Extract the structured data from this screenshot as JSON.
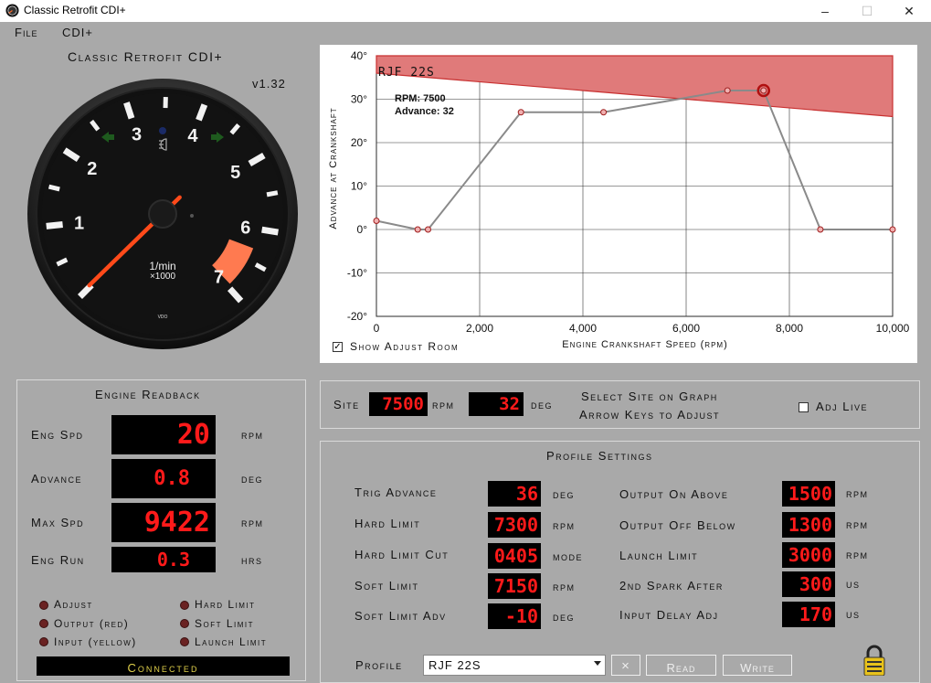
{
  "window": {
    "title": "Classic Retrofit CDI+",
    "minimize": "–",
    "maximize": "☐",
    "close": "✕"
  },
  "menu": {
    "file": "File",
    "cdi": "CDI+"
  },
  "app": {
    "title": "Classic Retrofit CDI+",
    "version": "v1.32"
  },
  "gauge": {
    "labels": [
      "1",
      "2",
      "3",
      "4",
      "5",
      "6",
      "7"
    ],
    "unit_line1": "1/min",
    "unit_line2": "×1000",
    "brand": "VDO",
    "value_krpm": 0.02,
    "redzone_start_krpm": 6.3,
    "redzone_end_krpm": 6.95
  },
  "chart_data": {
    "type": "line",
    "annotation_title": "RJF 22S",
    "tooltip": {
      "rpm_text": "RPM: 7500",
      "adv_text": "Advance: 32"
    },
    "xlabel": "Engine Crankshaft Speed (rpm)",
    "ylabel": "Advance at Crankshaft",
    "xlim": [
      0,
      10000
    ],
    "ylim": [
      -20,
      40
    ],
    "xticks": [
      "0",
      "2,000",
      "4,000",
      "6,000",
      "8,000",
      "10,000"
    ],
    "yticks": [
      "40°",
      "30°",
      "20°",
      "10°",
      "0°",
      "-10°",
      "-20°"
    ],
    "grid": true,
    "series": [
      {
        "points": [
          [
            0,
            2
          ],
          [
            800,
            0
          ],
          [
            1000,
            0
          ],
          [
            2800,
            27
          ],
          [
            4400,
            27
          ],
          [
            6800,
            32
          ],
          [
            7500,
            32
          ],
          [
            8600,
            0
          ],
          [
            10000,
            0
          ]
        ]
      }
    ],
    "adjust_room": {
      "start": [
        0,
        36
      ],
      "end": [
        10000,
        26
      ]
    },
    "selected": [
      7500,
      32
    ]
  },
  "show_adjust": {
    "checked": true,
    "label": "Show Adjust Room",
    "mark": "✓"
  },
  "readback": {
    "title": "Engine Readback",
    "eng_spd": {
      "label": "Eng Spd",
      "value": "20",
      "unit": "rpm"
    },
    "advance": {
      "label": "Advance",
      "value": "0.8",
      "unit": "deg"
    },
    "max_spd": {
      "label": "Max Spd",
      "value": "9422",
      "unit": "rpm"
    },
    "eng_run": {
      "label": "Eng Run",
      "value": "0.3",
      "unit": "hrs"
    },
    "indicators": [
      "Adjust",
      "Output (red)",
      "Input (yellow)",
      "Hard Limit",
      "Soft Limit",
      "Launch Limit"
    ],
    "status": "Connected"
  },
  "site": {
    "label": "Site",
    "rpm_value": "7500",
    "rpm_unit": "rpm",
    "deg_value": "32",
    "deg_unit": "deg",
    "hint1": "Select Site on Graph",
    "hint2": "Arrow Keys to Adjust",
    "adj_live": "Adj Live"
  },
  "profile": {
    "title": "Profile Settings",
    "trig_advance": {
      "label": "Trig Advance",
      "value": "36",
      "unit": "deg"
    },
    "hard_limit": {
      "label": "Hard Limit",
      "value": "7300",
      "unit": "rpm"
    },
    "hard_limit_cut": {
      "label": "Hard Limit Cut",
      "value": "0405",
      "unit": "mode"
    },
    "soft_limit": {
      "label": "Soft Limit",
      "value": "7150",
      "unit": "rpm"
    },
    "soft_limit_adv": {
      "label": "Soft Limit Adv",
      "value": "-10",
      "unit": "deg"
    },
    "output_on_above": {
      "label": "Output On Above",
      "value": "1500",
      "unit": "rpm"
    },
    "output_off_below": {
      "label": "Output Off Below",
      "value": "1300",
      "unit": "rpm"
    },
    "launch_limit": {
      "label": "Launch Limit",
      "value": "3000",
      "unit": "rpm"
    },
    "second_spark_after": {
      "label": "2nd Spark After",
      "value": "300",
      "unit": "us"
    },
    "input_delay_adj": {
      "label": "Input Delay Adj",
      "value": "170",
      "unit": "us"
    },
    "profile_label": "Profile",
    "profile_value": "RJF 22S",
    "clear_btn": "×",
    "read_btn": "Read",
    "write_btn": "Write"
  },
  "colors": {
    "led_red": "#ff1a1a",
    "panel_bg": "#a9a9a9",
    "adjust_fill": "#e07a7a",
    "line": "#8a8a8a"
  }
}
